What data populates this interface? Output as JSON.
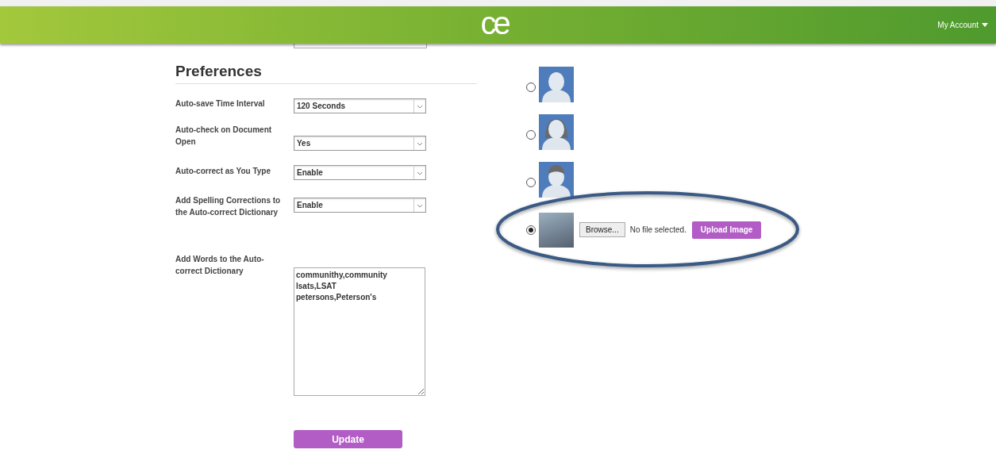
{
  "header": {
    "logo": "ce",
    "account_menu": "My Account"
  },
  "preferences": {
    "title": "Preferences",
    "settings": [
      {
        "label": "Auto-save Time Interval",
        "value": "120 Seconds"
      },
      {
        "label": "Auto-check on Document Open",
        "value": "Yes"
      },
      {
        "label": "Auto-correct as You Type",
        "value": "Enable"
      },
      {
        "label": "Add Spelling Corrections to the Auto-correct Dictionary",
        "value": "Enable"
      }
    ],
    "dictionary": {
      "label": "Add Words to the Auto-correct Dictionary",
      "lines": [
        "communithy,community",
        "lsats,LSAT",
        "petersons,Peterson's"
      ]
    },
    "update_button": "Update"
  },
  "avatars": [
    {
      "kind": "silhouette",
      "selected": false
    },
    {
      "kind": "female",
      "selected": false
    },
    {
      "kind": "male",
      "selected": false
    },
    {
      "kind": "photo",
      "selected": true
    }
  ],
  "upload": {
    "browse_button": "Browse...",
    "file_status": "No file selected.",
    "upload_button": "Upload Image"
  }
}
